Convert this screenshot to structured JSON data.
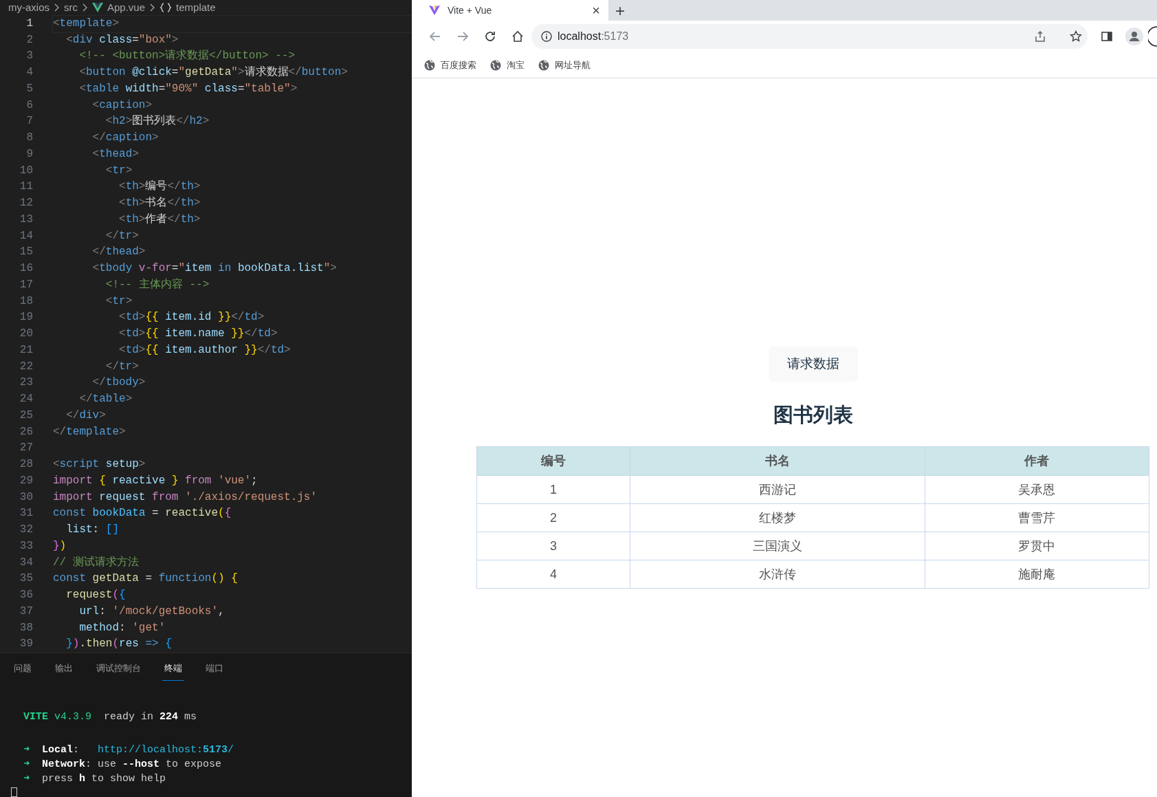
{
  "editor": {
    "breadcrumb": [
      {
        "label": "my-axios",
        "kind": "folder"
      },
      {
        "label": "src",
        "kind": "folder"
      },
      {
        "label": "App.vue",
        "kind": "vue"
      },
      {
        "label": "template",
        "kind": "braces"
      }
    ],
    "lines": [
      {
        "number": "1",
        "current": true,
        "tokens": [
          {
            "kind": "p",
            "text": "<"
          },
          {
            "kind": "tg",
            "text": "template"
          },
          {
            "kind": "p",
            "text": ">"
          }
        ]
      },
      {
        "number": "2",
        "current": false,
        "tokens": [
          {
            "kind": "p",
            "text": "  <"
          },
          {
            "kind": "tg",
            "text": "div"
          },
          {
            "kind": "at",
            "text": " class"
          },
          {
            "kind": "x",
            "text": "="
          },
          {
            "kind": "s",
            "text": "\"box\""
          },
          {
            "kind": "p",
            "text": ">"
          }
        ]
      },
      {
        "number": "3",
        "current": false,
        "tokens": [
          {
            "kind": "c",
            "text": "    <!-- <button>请求数据</button> -->"
          }
        ]
      },
      {
        "number": "4",
        "current": false,
        "tokens": [
          {
            "kind": "p",
            "text": "    <"
          },
          {
            "kind": "tg",
            "text": "button"
          },
          {
            "kind": "at",
            "text": " @click"
          },
          {
            "kind": "x",
            "text": "="
          },
          {
            "kind": "s",
            "text": "\""
          },
          {
            "kind": "fn",
            "text": "getData"
          },
          {
            "kind": "s",
            "text": "\""
          },
          {
            "kind": "p",
            "text": ">"
          },
          {
            "kind": "x",
            "text": "请求数据"
          },
          {
            "kind": "p",
            "text": "</"
          },
          {
            "kind": "tg",
            "text": "button"
          },
          {
            "kind": "p",
            "text": ">"
          }
        ]
      },
      {
        "number": "5",
        "current": false,
        "tokens": [
          {
            "kind": "p",
            "text": "    <"
          },
          {
            "kind": "tg",
            "text": "table"
          },
          {
            "kind": "at",
            "text": " width"
          },
          {
            "kind": "x",
            "text": "="
          },
          {
            "kind": "s",
            "text": "\"90%\""
          },
          {
            "kind": "at",
            "text": " class"
          },
          {
            "kind": "x",
            "text": "="
          },
          {
            "kind": "s",
            "text": "\"table\""
          },
          {
            "kind": "p",
            "text": ">"
          }
        ]
      },
      {
        "number": "6",
        "current": false,
        "tokens": [
          {
            "kind": "p",
            "text": "      <"
          },
          {
            "kind": "tg",
            "text": "caption"
          },
          {
            "kind": "p",
            "text": ">"
          }
        ]
      },
      {
        "number": "7",
        "current": false,
        "tokens": [
          {
            "kind": "p",
            "text": "        <"
          },
          {
            "kind": "tg",
            "text": "h2"
          },
          {
            "kind": "p",
            "text": ">"
          },
          {
            "kind": "x",
            "text": "图书列表"
          },
          {
            "kind": "p",
            "text": "</"
          },
          {
            "kind": "tg",
            "text": "h2"
          },
          {
            "kind": "p",
            "text": ">"
          }
        ]
      },
      {
        "number": "8",
        "current": false,
        "tokens": [
          {
            "kind": "p",
            "text": "      </"
          },
          {
            "kind": "tg",
            "text": "caption"
          },
          {
            "kind": "p",
            "text": ">"
          }
        ]
      },
      {
        "number": "9",
        "current": false,
        "tokens": [
          {
            "kind": "p",
            "text": "      <"
          },
          {
            "kind": "tg",
            "text": "thead"
          },
          {
            "kind": "p",
            "text": ">"
          }
        ]
      },
      {
        "number": "10",
        "current": false,
        "tokens": [
          {
            "kind": "p",
            "text": "        <"
          },
          {
            "kind": "tg",
            "text": "tr"
          },
          {
            "kind": "p",
            "text": ">"
          }
        ]
      },
      {
        "number": "11",
        "current": false,
        "tokens": [
          {
            "kind": "p",
            "text": "          <"
          },
          {
            "kind": "tg",
            "text": "th"
          },
          {
            "kind": "p",
            "text": ">"
          },
          {
            "kind": "x",
            "text": "编号"
          },
          {
            "kind": "p",
            "text": "</"
          },
          {
            "kind": "tg",
            "text": "th"
          },
          {
            "kind": "p",
            "text": ">"
          }
        ]
      },
      {
        "number": "12",
        "current": false,
        "tokens": [
          {
            "kind": "p",
            "text": "          <"
          },
          {
            "kind": "tg",
            "text": "th"
          },
          {
            "kind": "p",
            "text": ">"
          },
          {
            "kind": "x",
            "text": "书名"
          },
          {
            "kind": "p",
            "text": "</"
          },
          {
            "kind": "tg",
            "text": "th"
          },
          {
            "kind": "p",
            "text": ">"
          }
        ]
      },
      {
        "number": "13",
        "current": false,
        "tokens": [
          {
            "kind": "p",
            "text": "          <"
          },
          {
            "kind": "tg",
            "text": "th"
          },
          {
            "kind": "p",
            "text": ">"
          },
          {
            "kind": "x",
            "text": "作者"
          },
          {
            "kind": "p",
            "text": "</"
          },
          {
            "kind": "tg",
            "text": "th"
          },
          {
            "kind": "p",
            "text": ">"
          }
        ]
      },
      {
        "number": "14",
        "current": false,
        "tokens": [
          {
            "kind": "p",
            "text": "        </"
          },
          {
            "kind": "tg",
            "text": "tr"
          },
          {
            "kind": "p",
            "text": ">"
          }
        ]
      },
      {
        "number": "15",
        "current": false,
        "tokens": [
          {
            "kind": "p",
            "text": "      </"
          },
          {
            "kind": "tg",
            "text": "thead"
          },
          {
            "kind": "p",
            "text": ">"
          }
        ]
      },
      {
        "number": "16",
        "current": false,
        "tokens": [
          {
            "kind": "p",
            "text": "      <"
          },
          {
            "kind": "tg",
            "text": "tbody"
          },
          {
            "kind": "kw",
            "text": " v-for"
          },
          {
            "kind": "x",
            "text": "="
          },
          {
            "kind": "s",
            "text": "\""
          },
          {
            "kind": "v",
            "text": "item"
          },
          {
            "kind": "st",
            "text": " in"
          },
          {
            "kind": "v",
            "text": " bookData.list"
          },
          {
            "kind": "s",
            "text": "\""
          },
          {
            "kind": "p",
            "text": ">"
          }
        ]
      },
      {
        "number": "17",
        "current": false,
        "tokens": [
          {
            "kind": "c",
            "text": "        <!-- 主体内容 -->"
          }
        ]
      },
      {
        "number": "18",
        "current": false,
        "tokens": [
          {
            "kind": "p",
            "text": "        <"
          },
          {
            "kind": "tg",
            "text": "tr"
          },
          {
            "kind": "p",
            "text": ">"
          }
        ]
      },
      {
        "number": "19",
        "current": false,
        "tokens": [
          {
            "kind": "p",
            "text": "          <"
          },
          {
            "kind": "tg",
            "text": "td"
          },
          {
            "kind": "p",
            "text": ">"
          },
          {
            "kind": "b1",
            "text": "{{"
          },
          {
            "kind": "v",
            "text": " item.id"
          },
          {
            "kind": "b1",
            "text": " }}"
          },
          {
            "kind": "p",
            "text": "</"
          },
          {
            "kind": "tg",
            "text": "td"
          },
          {
            "kind": "p",
            "text": ">"
          }
        ]
      },
      {
        "number": "20",
        "current": false,
        "tokens": [
          {
            "kind": "p",
            "text": "          <"
          },
          {
            "kind": "tg",
            "text": "td"
          },
          {
            "kind": "p",
            "text": ">"
          },
          {
            "kind": "b1",
            "text": "{{"
          },
          {
            "kind": "v",
            "text": " item.name"
          },
          {
            "kind": "b1",
            "text": " }}"
          },
          {
            "kind": "p",
            "text": "</"
          },
          {
            "kind": "tg",
            "text": "td"
          },
          {
            "kind": "p",
            "text": ">"
          }
        ]
      },
      {
        "number": "21",
        "current": false,
        "tokens": [
          {
            "kind": "p",
            "text": "          <"
          },
          {
            "kind": "tg",
            "text": "td"
          },
          {
            "kind": "p",
            "text": ">"
          },
          {
            "kind": "b1",
            "text": "{{"
          },
          {
            "kind": "v",
            "text": " item.author"
          },
          {
            "kind": "b1",
            "text": " }}"
          },
          {
            "kind": "p",
            "text": "</"
          },
          {
            "kind": "tg",
            "text": "td"
          },
          {
            "kind": "p",
            "text": ">"
          }
        ]
      },
      {
        "number": "22",
        "current": false,
        "tokens": [
          {
            "kind": "p",
            "text": "        </"
          },
          {
            "kind": "tg",
            "text": "tr"
          },
          {
            "kind": "p",
            "text": ">"
          }
        ]
      },
      {
        "number": "23",
        "current": false,
        "tokens": [
          {
            "kind": "p",
            "text": "      </"
          },
          {
            "kind": "tg",
            "text": "tbody"
          },
          {
            "kind": "p",
            "text": ">"
          }
        ]
      },
      {
        "number": "24",
        "current": false,
        "tokens": [
          {
            "kind": "p",
            "text": "    </"
          },
          {
            "kind": "tg",
            "text": "table"
          },
          {
            "kind": "p",
            "text": ">"
          }
        ]
      },
      {
        "number": "25",
        "current": false,
        "tokens": [
          {
            "kind": "p",
            "text": "  </"
          },
          {
            "kind": "tg",
            "text": "div"
          },
          {
            "kind": "p",
            "text": ">"
          }
        ]
      },
      {
        "number": "26",
        "current": false,
        "tokens": [
          {
            "kind": "p",
            "text": "</"
          },
          {
            "kind": "tg",
            "text": "template"
          },
          {
            "kind": "p",
            "text": ">"
          }
        ]
      },
      {
        "number": "27",
        "current": false
      },
      {
        "number": "28",
        "current": false,
        "tokens": [
          {
            "kind": "p",
            "text": "<"
          },
          {
            "kind": "tg",
            "text": "script"
          },
          {
            "kind": "at",
            "text": " setup"
          },
          {
            "kind": "p",
            "text": ">"
          }
        ]
      },
      {
        "number": "29",
        "current": false,
        "tokens": [
          {
            "kind": "kw",
            "text": "import"
          },
          {
            "kind": "b1",
            "text": " {"
          },
          {
            "kind": "v",
            "text": " reactive"
          },
          {
            "kind": "b1",
            "text": " }"
          },
          {
            "kind": "kw",
            "text": " from"
          },
          {
            "kind": "s",
            "text": " 'vue'"
          },
          {
            "kind": "x",
            "text": ";"
          }
        ]
      },
      {
        "number": "30",
        "current": false,
        "tokens": [
          {
            "kind": "kw",
            "text": "import"
          },
          {
            "kind": "v",
            "text": " request"
          },
          {
            "kind": "kw",
            "text": " from"
          },
          {
            "kind": "s",
            "text": " './axios/request.js'"
          }
        ]
      },
      {
        "number": "31",
        "current": false,
        "tokens": [
          {
            "kind": "st",
            "text": "const"
          },
          {
            "kind": "cn",
            "text": " bookData"
          },
          {
            "kind": "x",
            "text": " = "
          },
          {
            "kind": "fn",
            "text": "reactive"
          },
          {
            "kind": "b1",
            "text": "("
          },
          {
            "kind": "b2",
            "text": "{"
          }
        ]
      },
      {
        "number": "32",
        "current": false,
        "tokens": [
          {
            "kind": "v",
            "text": "  list"
          },
          {
            "kind": "x",
            "text": ": "
          },
          {
            "kind": "b3",
            "text": "[]"
          }
        ]
      },
      {
        "number": "33",
        "current": false,
        "tokens": [
          {
            "kind": "b2",
            "text": "}"
          },
          {
            "kind": "b1",
            "text": ")"
          }
        ]
      },
      {
        "number": "34",
        "current": false,
        "tokens": [
          {
            "kind": "c",
            "text": "// 测试请求方法"
          }
        ]
      },
      {
        "number": "35",
        "current": false,
        "tokens": [
          {
            "kind": "st",
            "text": "const"
          },
          {
            "kind": "fn",
            "text": " getData"
          },
          {
            "kind": "x",
            "text": " = "
          },
          {
            "kind": "st",
            "text": "function"
          },
          {
            "kind": "b1",
            "text": "()"
          },
          {
            "kind": "b1",
            "text": " {"
          }
        ]
      },
      {
        "number": "36",
        "current": false,
        "tokens": [
          {
            "kind": "fn",
            "text": "  request"
          },
          {
            "kind": "b2",
            "text": "("
          },
          {
            "kind": "b3",
            "text": "{"
          }
        ]
      },
      {
        "number": "37",
        "current": false,
        "tokens": [
          {
            "kind": "v",
            "text": "    url"
          },
          {
            "kind": "x",
            "text": ": "
          },
          {
            "kind": "s",
            "text": "'/mock/getBooks'"
          },
          {
            "kind": "x",
            "text": ","
          }
        ]
      },
      {
        "number": "38",
        "current": false,
        "tokens": [
          {
            "kind": "v",
            "text": "    method"
          },
          {
            "kind": "x",
            "text": ": "
          },
          {
            "kind": "s",
            "text": "'get'"
          }
        ]
      },
      {
        "number": "39",
        "current": false,
        "tokens": [
          {
            "kind": "b3",
            "text": "  }"
          },
          {
            "kind": "b2",
            "text": ")"
          },
          {
            "kind": "x",
            "text": "."
          },
          {
            "kind": "fn",
            "text": "then"
          },
          {
            "kind": "b2",
            "text": "("
          },
          {
            "kind": "v",
            "text": "res"
          },
          {
            "kind": "st",
            "text": " =>"
          },
          {
            "kind": "b3",
            "text": " {"
          }
        ]
      }
    ]
  },
  "panel": {
    "tabs": [
      {
        "label": "问题",
        "selected": false
      },
      {
        "label": "输出",
        "selected": false
      },
      {
        "label": "调试控制台",
        "selected": false
      },
      {
        "label": "终端",
        "selected": true
      },
      {
        "label": "端口",
        "selected": false
      }
    ],
    "terminal": [
      {
        "lines": [
          {
            "tokens": [
              {
                "kind": "gb",
                "text": "VITE"
              },
              {
                "kind": "g",
                "text": " v4.3.9"
              },
              {
                "kind": "x",
                "text": "  ready in "
              },
              {
                "kind": "b",
                "text": "224"
              },
              {
                "kind": "x",
                "text": " ms"
              }
            ]
          }
        ]
      },
      {
        "lines": [
          {
            "tokens": [
              {
                "kind": "g",
                "text": "➜"
              },
              {
                "kind": "b",
                "text": "  Local"
              },
              {
                "kind": "x",
                "text": ":   "
              },
              {
                "kind": "u",
                "text": "http://localhost:"
              },
              {
                "kind": "ub",
                "text": "5173"
              },
              {
                "kind": "u",
                "text": "/"
              }
            ]
          },
          {
            "tokens": [
              {
                "kind": "g",
                "text": "➜"
              },
              {
                "kind": "b",
                "text": "  Network"
              },
              {
                "kind": "x",
                "text": ": use "
              },
              {
                "kind": "b",
                "text": "--host"
              },
              {
                "kind": "x",
                "text": " to expose"
              }
            ]
          },
          {
            "tokens": [
              {
                "kind": "g",
                "text": "➜"
              },
              {
                "kind": "x",
                "text": "  press "
              },
              {
                "kind": "b",
                "text": "h"
              },
              {
                "kind": "x",
                "text": " to show help"
              }
            ]
          }
        ]
      }
    ]
  },
  "browser": {
    "tab": {
      "title": "Vite + Vue",
      "close": "×"
    },
    "new_tab": "+",
    "address": {
      "host": "localhost",
      "port": ":5173"
    },
    "bookmarks": [
      "百度搜索",
      "淘宝",
      "网址导航"
    ],
    "page": {
      "button": "请求数据",
      "caption": "图书列表",
      "table": {
        "columns": [
          "编号",
          "书名",
          "作者"
        ],
        "rows": [
          [
            "1",
            "西游记",
            "吴承恩"
          ],
          [
            "2",
            "红楼梦",
            "曹雪芹"
          ],
          [
            "3",
            "三国演义",
            "罗贯中"
          ],
          [
            "4",
            "水浒传",
            "施耐庵"
          ]
        ]
      }
    }
  }
}
